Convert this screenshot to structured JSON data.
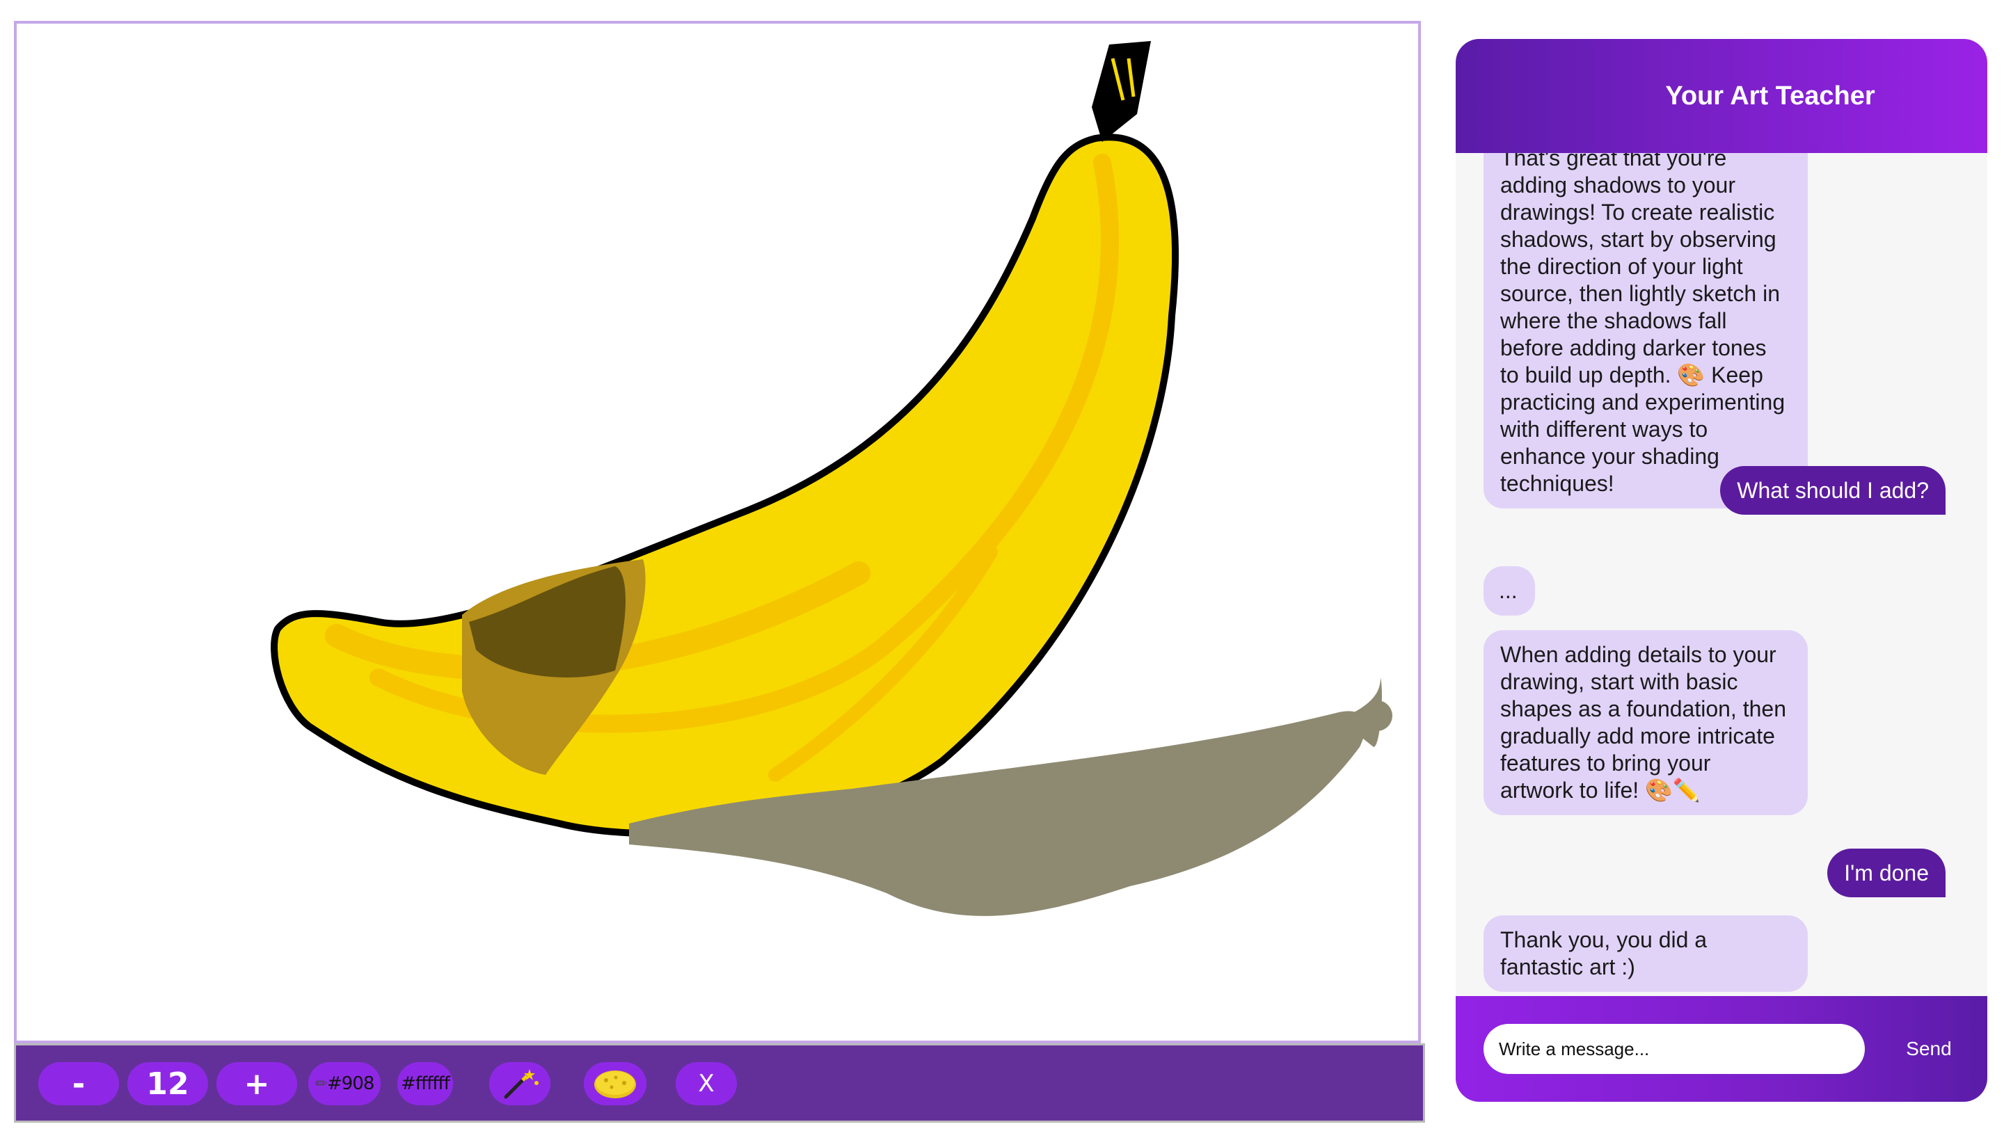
{
  "toolbar": {
    "decrease_label": "-",
    "brush_size": "12",
    "increase_label": "+",
    "primary_color": "#908",
    "secondary_color": "#ffffff",
    "clear_label": "X",
    "icons": {
      "primary_color": "pencil-icon",
      "magic": "magic-wand-icon",
      "eraser": "sponge-icon"
    }
  },
  "chat": {
    "title": "Your Art Teacher",
    "messages": [
      {
        "role": "bot",
        "lines": [
          "That's great that you're",
          "adding shadows to your",
          "drawings! To create realistic",
          "shadows, start by observing",
          "the direction of your light",
          "source, then lightly sketch in",
          "where the shadows fall",
          "before adding darker tones",
          "to build up depth. 🎨 Keep",
          "practicing and experimenting",
          "with different ways to",
          "enhance your shading",
          "techniques!"
        ]
      },
      {
        "role": "user",
        "text": "What should I add?"
      },
      {
        "role": "bot",
        "lines": [
          "..."
        ]
      },
      {
        "role": "bot",
        "lines": [
          "When adding details to your",
          "drawing, start with basic",
          "shapes as a foundation, then",
          "gradually add more intricate",
          "features to bring your",
          "artwork to life! 🎨✏️"
        ]
      },
      {
        "role": "user",
        "text": "I'm done"
      },
      {
        "role": "bot",
        "lines": [
          "Thank you, you did a",
          "fantastic art :)"
        ]
      }
    ],
    "input_placeholder": "Write a message...",
    "send_label": "Send"
  },
  "colors": {
    "toolbar_bg": "#63309a",
    "button_bg": "#8f28e6",
    "bot_bubble": "#e1d3f8",
    "user_bubble": "#5b1b9e",
    "canvas_border": "#c4a8e8"
  }
}
